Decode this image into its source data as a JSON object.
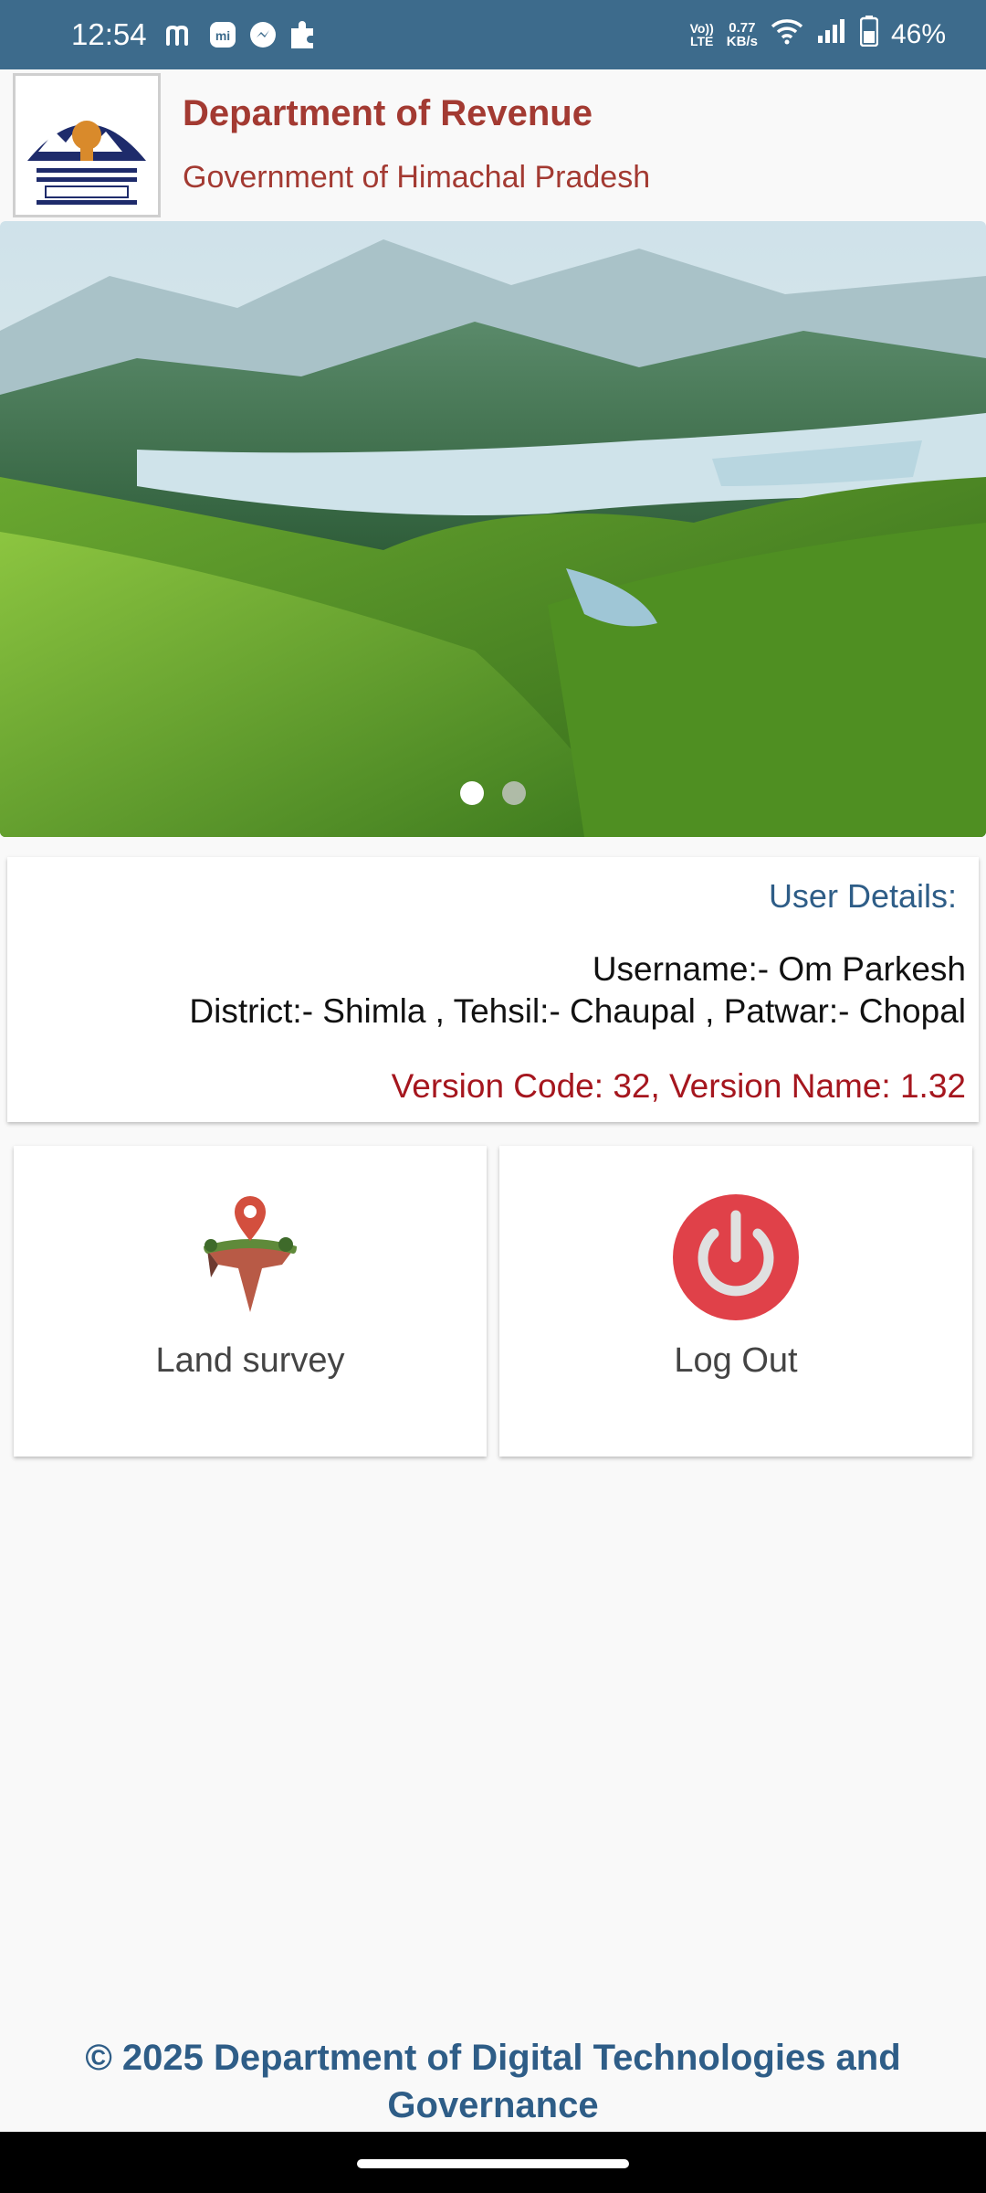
{
  "status_bar": {
    "time": "12:54",
    "left_icons": [
      "m-icon",
      "mi-icon",
      "messenger-icon",
      "puzzle-icon"
    ],
    "volte_line1": "Vo))",
    "volte_line2": "LTE",
    "speed_value": "0.77",
    "speed_unit": "KB/s",
    "battery": "46%"
  },
  "header": {
    "title": "Department of Revenue",
    "subtitle": "Government of Himachal Pradesh"
  },
  "carousel": {
    "slide_count": 2,
    "active_index": 0
  },
  "user_card": {
    "label": "User Details:",
    "username": "Username:- Om Parkesh",
    "location": "District:- Shimla , Tehsil:- Chaupal , Patwar:- Chopal",
    "version": "Version Code: 32, Version Name: 1.32"
  },
  "tiles": [
    {
      "label": "Land survey",
      "icon": "land-survey-icon"
    },
    {
      "label": "Log Out",
      "icon": "power-icon"
    }
  ],
  "footer": {
    "copyright": "© 2025 Department of Digital Technologies and Governance"
  },
  "colors": {
    "status_bar": "#3d6b8c",
    "header_text": "#a33a32",
    "accent_blue": "#2e5d87",
    "version_red": "#a5161e",
    "logout_red": "#e04149"
  }
}
